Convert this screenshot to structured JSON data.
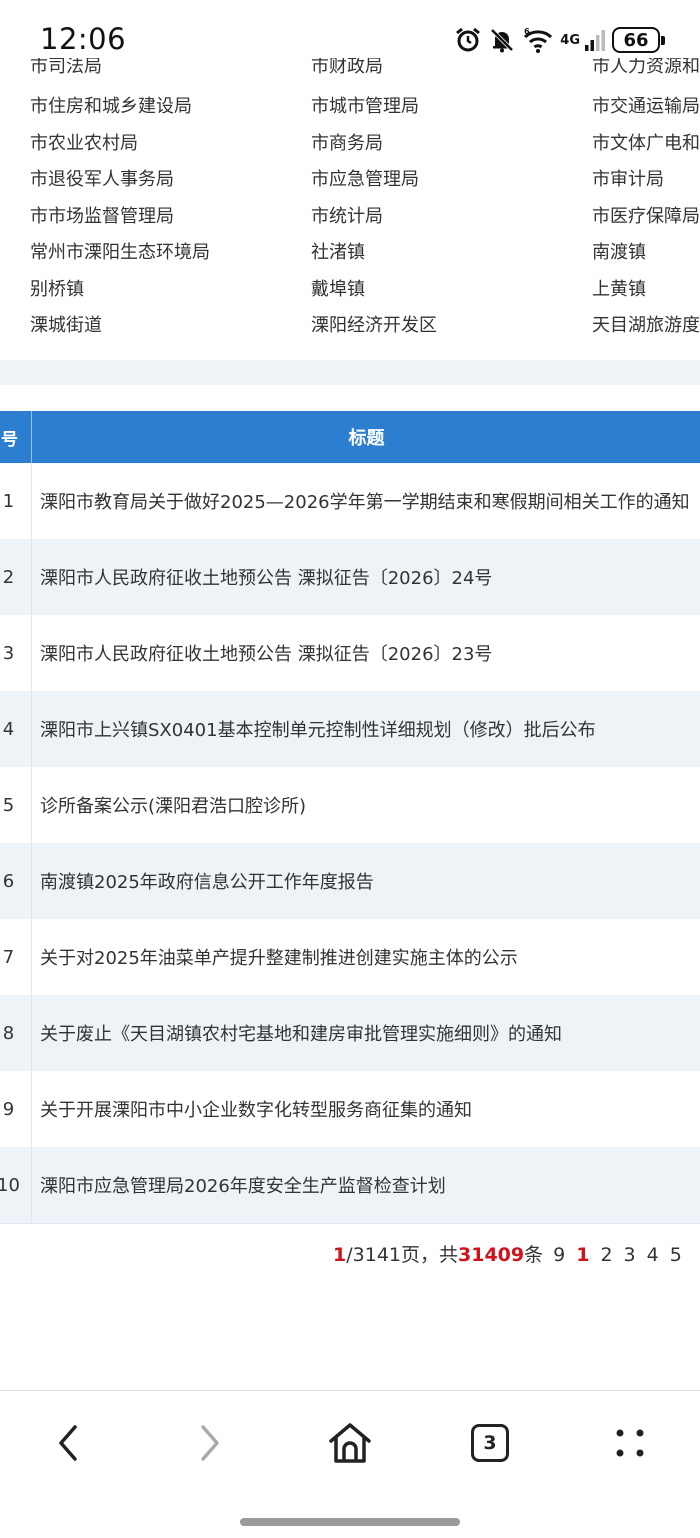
{
  "status_bar": {
    "time": "12:06",
    "network_label": "4G",
    "battery": "66",
    "icons": [
      "alarm-icon",
      "mute-bell-icon",
      "wifi-icon",
      "signal-icon",
      "battery-icon"
    ]
  },
  "departments": {
    "partial_top": [
      "市司法局",
      "市财政局",
      "市人力资源和"
    ],
    "rows": [
      [
        "市住房和城乡建设局",
        "市城市管理局",
        "市交通运输局"
      ],
      [
        "市农业农村局",
        "市商务局",
        "市文体广电和"
      ],
      [
        "市退役军人事务局",
        "市应急管理局",
        "市审计局"
      ],
      [
        "市市场监督管理局",
        "市统计局",
        "市医疗保障局"
      ],
      [
        "常州市溧阳生态环境局",
        "社渚镇",
        "南渡镇"
      ],
      [
        "别桥镇",
        "戴埠镇",
        "上黄镇"
      ],
      [
        "溧城街道",
        "溧阳经济开发区",
        "天目湖旅游度"
      ]
    ]
  },
  "table": {
    "header_num": "号",
    "header_title": "标题",
    "rows": [
      {
        "num": "1",
        "title": "溧阳市教育局关于做好2025—2026学年第一学期结束和寒假期间相关工作的通知"
      },
      {
        "num": "2",
        "title": "溧阳市人民政府征收土地预公告 溧拟征告〔2026〕24号"
      },
      {
        "num": "3",
        "title": "溧阳市人民政府征收土地预公告 溧拟征告〔2026〕23号"
      },
      {
        "num": "4",
        "title": "溧阳市上兴镇SX0401基本控制单元控制性详细规划（修改）批后公布"
      },
      {
        "num": "5",
        "title": "诊所备案公示(溧阳君浩口腔诊所)"
      },
      {
        "num": "6",
        "title": "南渡镇2025年政府信息公开工作年度报告"
      },
      {
        "num": "7",
        "title": "关于对2025年油菜单产提升整建制推进创建实施主体的公示"
      },
      {
        "num": "8",
        "title": "关于废止《天目湖镇农村宅基地和建房审批管理实施细则》的通知"
      },
      {
        "num": "9",
        "title": "关于开展溧阳市中小企业数字化转型服务商征集的通知"
      },
      {
        "num": "10",
        "title": "溧阳市应急管理局2026年度安全生产监督检查计划"
      }
    ]
  },
  "pagination": {
    "current_page": "1",
    "total_pages_text": "/3141页，共",
    "total_records": "31409",
    "records_suffix": "条",
    "prev_partial": "9",
    "pages": [
      "1",
      "2",
      "3",
      "4",
      "5"
    ]
  },
  "bottom_nav": {
    "tab_count": "3",
    "icons": [
      "back-arrow-icon",
      "forward-arrow-icon",
      "home-icon",
      "tabs-icon",
      "menu-dots-icon"
    ]
  }
}
